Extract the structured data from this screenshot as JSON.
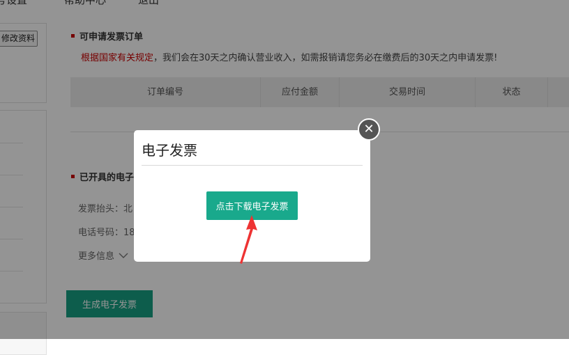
{
  "topnav": {
    "items": [
      "号设置",
      "帮助中心",
      "退出"
    ]
  },
  "sidebar": {
    "edit_profile_label": "修改资料"
  },
  "invoice_orders": {
    "title": "可申请发票订单",
    "notice_red": "根据国家有关规定",
    "notice_rest": "，我们会在30天之内确认营业收入，如需报销请您务必在缴费后的30天之内申请发票!",
    "columns": [
      "订单编号",
      "应付金额",
      "交易时间",
      "状态"
    ]
  },
  "issued": {
    "title": "已开具的电子",
    "invoice_header_label": "发票抬头：北",
    "phone_label": "电话号码：18",
    "more_info_label": "更多信息",
    "generate_label": "生成电子发票"
  },
  "modal": {
    "title": "电子发票",
    "download_label": "点击下载电子发票",
    "close_glyph": "✕"
  },
  "colors": {
    "accent": "#19a98c",
    "notice_red": "#cc0000",
    "overlay": "rgba(0,0,0,0.42)"
  },
  "icons": {
    "close": "close-icon",
    "chevron": "chevron-down-icon",
    "arrow": "arrow-pointer-icon"
  }
}
